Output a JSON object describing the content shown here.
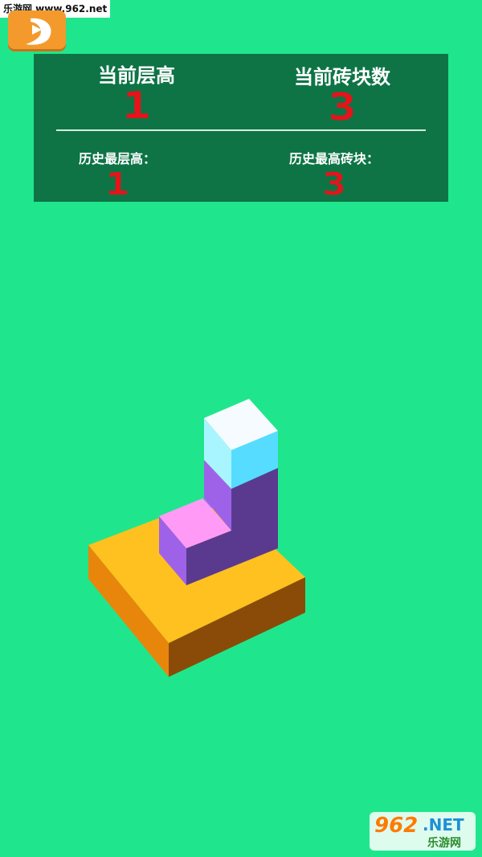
{
  "watermark_top": "乐游网 www.962.net",
  "back_button": {
    "icon": "back-arrow-icon"
  },
  "stats": {
    "current_height_label": "当前层高",
    "current_height_value": "1",
    "current_bricks_label": "当前砖块数",
    "current_bricks_value": "3",
    "best_height_label": "历史最层高：",
    "best_height_value": "1",
    "best_bricks_label": "历史最高砖块：",
    "best_bricks_value": "3"
  },
  "watermark_logo": {
    "number": "962",
    "suffix": ".NET",
    "name": "乐游网"
  },
  "colors": {
    "background": "#1fe68c",
    "panel": "#0e7446",
    "value_red": "#e3141a",
    "back_button": "#f49a2c"
  }
}
